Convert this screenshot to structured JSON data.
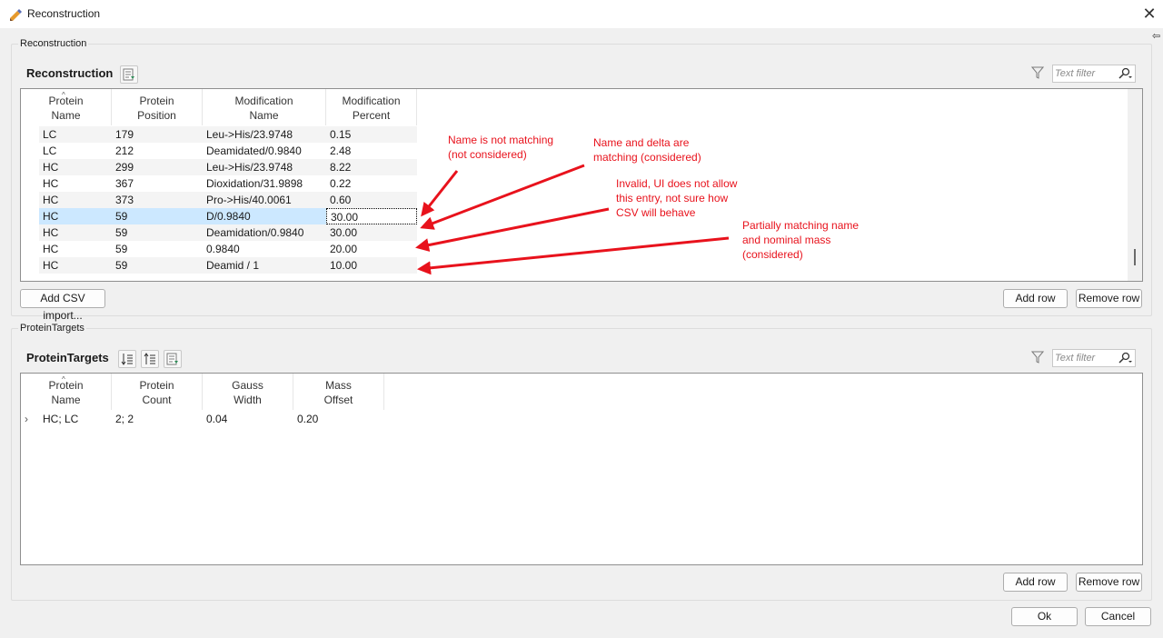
{
  "window": {
    "title": "Reconstruction"
  },
  "reconstruction_group": {
    "legend": "Reconstruction",
    "title": "Reconstruction",
    "filter_placeholder": "Text filter",
    "columns": [
      {
        "line1": "Protein",
        "line2": "Name"
      },
      {
        "line1": "Protein",
        "line2": "Position"
      },
      {
        "line1": "Modification",
        "line2": "Name"
      },
      {
        "line1": "Modification",
        "line2": "Percent"
      }
    ],
    "rows": [
      {
        "name": "LC",
        "position": "179",
        "modification": "Leu->His/23.9748",
        "percent": "0.15"
      },
      {
        "name": "LC",
        "position": "212",
        "modification": "Deamidated/0.9840",
        "percent": "2.48"
      },
      {
        "name": "HC",
        "position": "299",
        "modification": "Leu->His/23.9748",
        "percent": "8.22"
      },
      {
        "name": "HC",
        "position": "367",
        "modification": "Dioxidation/31.9898",
        "percent": "0.22"
      },
      {
        "name": "HC",
        "position": "373",
        "modification": "Pro->His/40.0061",
        "percent": "0.60"
      },
      {
        "name": "HC",
        "position": "59",
        "modification": "D/0.9840",
        "percent": "30.00"
      },
      {
        "name": "HC",
        "position": "59",
        "modification": "Deamidation/0.9840",
        "percent": "30.00"
      },
      {
        "name": "HC",
        "position": "59",
        "modification": "0.9840",
        "percent": "20.00"
      },
      {
        "name": "HC",
        "position": "59",
        "modification": "Deamid / 1",
        "percent": "10.00"
      }
    ],
    "selected_row_index": 5,
    "csv_button": "Add CSV import...",
    "add_row": "Add row",
    "remove_row": "Remove row"
  },
  "annotations": {
    "name_not_matching": [
      "Name is not matching",
      "(not considered)"
    ],
    "name_delta_matching": [
      "Name and delta are",
      "matching (considered)"
    ],
    "invalid": [
      "Invalid, UI does not allow",
      "this entry, not sure how",
      "CSV will behave"
    ],
    "partial": [
      "Partially matching name",
      "and nominal mass",
      "(considered)"
    ],
    "color": "#e8121c"
  },
  "targets_group": {
    "legend": "ProteinTargets",
    "title": "ProteinTargets",
    "filter_placeholder": "Text filter",
    "columns": [
      {
        "line1": "Protein",
        "line2": "Name"
      },
      {
        "line1": "Protein",
        "line2": "Count"
      },
      {
        "line1": "Gauss",
        "line2": "Width"
      },
      {
        "line1": "Mass",
        "line2": "Offset"
      }
    ],
    "rows": [
      {
        "name": "HC; LC",
        "count": "2; 2",
        "gauss": "0.04",
        "offset": "0.20"
      }
    ],
    "add_row": "Add row",
    "remove_row": "Remove row"
  },
  "footer": {
    "ok": "Ok",
    "cancel": "Cancel"
  },
  "icons": {
    "app": "app-icon",
    "close": "close-icon",
    "filter": "filter-icon",
    "search": "search-icon",
    "export": "export-icon",
    "sort_desc": "sort-descending-icon",
    "sort_asc": "sort-ascending-icon",
    "expand": "chevron-right-icon"
  }
}
